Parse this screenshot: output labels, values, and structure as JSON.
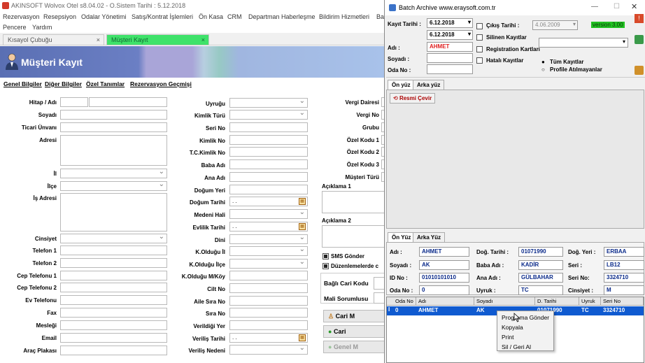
{
  "app": {
    "title": "AKINSOFT Wolvox Otel s8.04.02 - O.Sistem Tarihi : 5.12.2018"
  },
  "menu": {
    "row1": [
      "Rezervasyon",
      "Resepsiyon",
      "Odalar Yönetimi",
      "Satış/Kontrat İşlemleri",
      "Ön Kasa",
      "CRM",
      "Departman Haberleşme",
      "Bildirim Hizmetleri",
      "Ba"
    ],
    "row2": [
      "Pencere",
      "Yardım"
    ]
  },
  "doc_tabs": [
    {
      "label": "Kısayol Çubuğu",
      "close": "×"
    },
    {
      "label": "Müşteri Kayıt",
      "close": "×"
    }
  ],
  "header": {
    "title": "Müşteri Kayıt"
  },
  "subtabs": [
    "Genel Bilgiler",
    "Diğer Bilgiler",
    "Özel Tanımlar",
    "Rezervasyon Geçmişi"
  ],
  "form_left": {
    "labels": [
      "Hitap / Adı",
      "Soyadı",
      "Ticari Ünvanı",
      "Adresi",
      "İl",
      "İlçe",
      "İş Adresi",
      "Cinsiyet",
      "Telefon 1",
      "Telefon 2",
      "Cep Telefonu 1",
      "Cep Telefonu 2",
      "Ev Telefonu",
      "Fax",
      "Mesleği",
      "Email",
      "Araç Plakası"
    ]
  },
  "form_mid": {
    "labels": [
      "Uyruğu",
      "Kimlik Türü",
      "Seri No",
      "Kimlik No",
      "T.C.Kimlik No",
      "Baba Adı",
      "Ana Adı",
      "Doğum Yeri",
      "Doğum Tarihi",
      "Medeni Hali",
      "Evlilik Tarihi",
      "Dini",
      "K.Olduğu İl",
      "K.Olduğu İlçe",
      "K.Olduğu M/Köy",
      "Cilt No",
      "Aile Sıra No",
      "Sıra No",
      "Verildiği Yer",
      "Veriliş Tarihi",
      "Veriliş Nedeni"
    ],
    "date_placeholder": ". ."
  },
  "form_right": {
    "labels": [
      "Vergi Dairesi",
      "Vergi No",
      "Grubu",
      "Özel Kodu 1",
      "Özel Kodu 2",
      "Özel Kodu 3",
      "Müşteri Türü"
    ],
    "aciklama1": "Açıklama 1",
    "aciklama2": "Açıklama 2",
    "sms_label": "SMS Gönder",
    "duzenle_label": "Düzenlemelerde c",
    "bagli_cari": "Bağlı Cari Kodu",
    "mali_sorumlu": "Mali Sorumlusu",
    "btn_cari1": "Cari M",
    "btn_cari2": "Cari",
    "btn_genel": "Genel M"
  },
  "batch": {
    "title": "Batch Archive www.eraysoft.com.tr",
    "kayit_tarihi_label": "Kayıt Tarihi :",
    "date1": "6.12.2018",
    "date2": "6.12.2018",
    "cikis_label": "Çıkış Tarihi :",
    "cikis_date": "4.06.2009",
    "version": "version 3.00",
    "silinen": "Silinen Kayıtlar",
    "registration": "Registration Kartları",
    "hatali": "Hatalı Kayıtlar",
    "adi_label": "Adı :",
    "adi_value": "AHMET",
    "soyadi_label": "Soyadı :",
    "odano_label": "Oda No :",
    "radio1": "Tüm Kayıtlar",
    "radio2": "Profile Atılmayanlar",
    "tabs_top": [
      "Ön yüz",
      "Arka yüz"
    ],
    "resmi_cevir": "Resmi Çevir",
    "tabs_bottom": [
      "Ön Yüz",
      "Arka Yüz"
    ],
    "detail": {
      "adi_l": "Adı :",
      "adi": "AHMET",
      "dogum_tarihi_l": "Doğ. Tarihi :",
      "dogum_tarihi": "01071990",
      "dogum_yeri_l": "Doğ. Yeri :",
      "dogum_yeri": "ERBAA",
      "soyadi_l": "Soyadı :",
      "soyadi": "AK",
      "baba_l": "Baba Adı :",
      "baba": "KADİR",
      "seri_l": "Seri :",
      "seri": "LB12",
      "id_l": "ID No :",
      "id": "01010101010",
      "ana_l": "Ana Adı :",
      "ana": "GÜLBAHAR",
      "serino_l": "Seri No:",
      "serino": "3324710",
      "oda_l": "Oda No :",
      "oda": "0",
      "uyruk_l": "Uyruk :",
      "uyruk": "TC",
      "cinsiyet_l": "Cinsiyet :",
      "cinsiyet": "M"
    },
    "grid": {
      "headers": [
        "Oda No",
        "Adı",
        "Soyadı",
        "D. Tarihi",
        "Uyruk",
        "Seri No"
      ],
      "row": [
        "0",
        "AHMET",
        "AK",
        "01071990",
        "TC",
        "3324710"
      ]
    }
  },
  "context_menu": [
    "Programa Gönder",
    "Kopyala",
    "Print",
    "Sil / Geri Al"
  ]
}
